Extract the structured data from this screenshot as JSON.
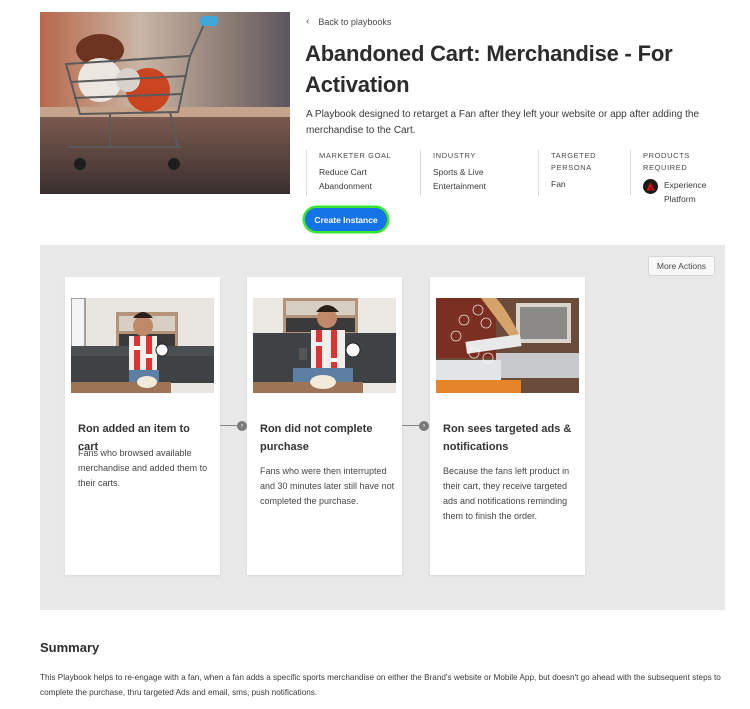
{
  "header": {
    "back_label": "Back to playbooks",
    "back_icon": "chevron-left-icon",
    "title": "Abandoned Cart: Merchandise - For Activation",
    "description": "A Playbook designed to retarget a Fan after they left your website or app after adding the merchandise to the Cart.",
    "hero_image": "shopping-cart-with-sports-balls"
  },
  "meta": [
    {
      "label": "MARKETER GOAL",
      "value": "Reduce Cart Abandonment"
    },
    {
      "label": "INDUSTRY",
      "value": "Sports & Live Entertainment"
    },
    {
      "label": "TARGETED PERSONA",
      "value": "Fan"
    },
    {
      "label": "PRODUCTS REQUIRED",
      "value": "Experience Platform",
      "icon": "adobe-experience-platform-icon"
    }
  ],
  "actions": {
    "create_label": "Create Instance",
    "more_label": "More Actions",
    "accent_color": "#1473e6",
    "focus_ring_color": "#39e82e"
  },
  "journey": [
    {
      "image": "fan-cheering-on-couch",
      "title": "Ron added an item to cart",
      "text": "Fans who browsed available merchandise and added them to their carts."
    },
    {
      "image": "fan-looking-at-phone",
      "title": "Ron did not complete purchase",
      "text": "Fans who were then interrupted and 30 minutes later still have not completed the purchase."
    },
    {
      "image": "person-with-tablet-and-icons",
      "title": "Ron sees targeted ads & notifications",
      "text": "Because the fans left product in their cart, they receive targeted ads and notifications reminding them to finish the order."
    }
  ],
  "summary": {
    "title": "Summary",
    "text": "This Playbook helps to re-engage with a fan, when a fan adds a specific sports merchandise on either the Brand's website or Mobile App, but doesn't go ahead with the subsequent steps to complete the purchase, thru targeted Ads and email, sms, push notifications."
  }
}
